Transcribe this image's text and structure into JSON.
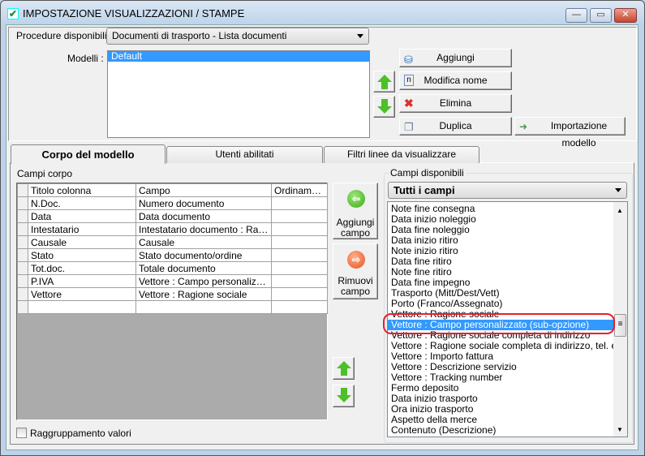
{
  "window": {
    "title": "IMPOSTAZIONE VISUALIZZAZIONI / STAMPE",
    "minimize": "—",
    "maximize": "▭",
    "close": "✕"
  },
  "top": {
    "procedure_label": "Procedure disponibili :",
    "procedure_value": "Documenti di trasporto - Lista documenti",
    "modelli_label": "Modelli :",
    "modelli": [
      "Default"
    ],
    "buttons": {
      "add": "Aggiungi",
      "rename": "Modifica nome",
      "delete": "Elimina",
      "duplicate": "Duplica",
      "import": "Importazione modello"
    }
  },
  "tabs": [
    {
      "label": "Corpo del modello",
      "active": true
    },
    {
      "label": "Utenti abilitati"
    },
    {
      "label": "Filtri linee da visualizzare"
    }
  ],
  "body": {
    "campi_corpo_label": "Campi corpo",
    "columns": [
      "Titolo colonna",
      "Campo",
      "Ordinamento"
    ],
    "rows": [
      [
        "N.Doc.",
        "Numero documento",
        ""
      ],
      [
        "Data",
        "Data documento",
        ""
      ],
      [
        "Intestatario",
        "Intestatario documento : Ragion...",
        ""
      ],
      [
        "Causale",
        "Causale",
        ""
      ],
      [
        "Stato",
        "Stato documento/ordine",
        ""
      ],
      [
        "Tot.doc.",
        "Totale documento",
        ""
      ],
      [
        "P.IVA",
        "Vettore : Campo personalizzato (...",
        ""
      ],
      [
        "Vettore",
        "Vettore : Ragione sociale",
        ""
      ]
    ],
    "add_field": "Aggiungi campo",
    "remove_field": "Rimuovi campo",
    "grouping_label": "Raggruppamento valori",
    "grouping_checked": false
  },
  "available": {
    "label": "Campi disponibili",
    "filter_value": "Tutti i campi",
    "selected_index": 11,
    "items": [
      "Note fine consegna",
      "Data inizio noleggio",
      "Data fine noleggio",
      "Data inizio ritiro",
      "Note inizio ritiro",
      "Data fine ritiro",
      "Note fine ritiro",
      "Data fine impegno",
      "Trasporto (Mitt/Dest/Vett)",
      "Porto (Franco/Assegnato)",
      "Vettore : Ragione sociale",
      "Vettore : Campo personalizzato (sub-opzione)",
      "Vettore : Ragione sociale completa di indirizzo",
      "Vettore : Ragione sociale completa di indirizzo, tel. e fax",
      "Vettore : Importo fattura",
      "Vettore : Descrizione servizio",
      "Vettore : Tracking number",
      "Fermo deposito",
      "Data inizio trasporto",
      "Ora inizio trasporto",
      "Aspetto della merce",
      "Contenuto (Descrizione)"
    ]
  },
  "colors": {
    "selection": "#3399ff",
    "highlight_ring": "#e8202a",
    "arrow_green": "#4cc02a"
  }
}
